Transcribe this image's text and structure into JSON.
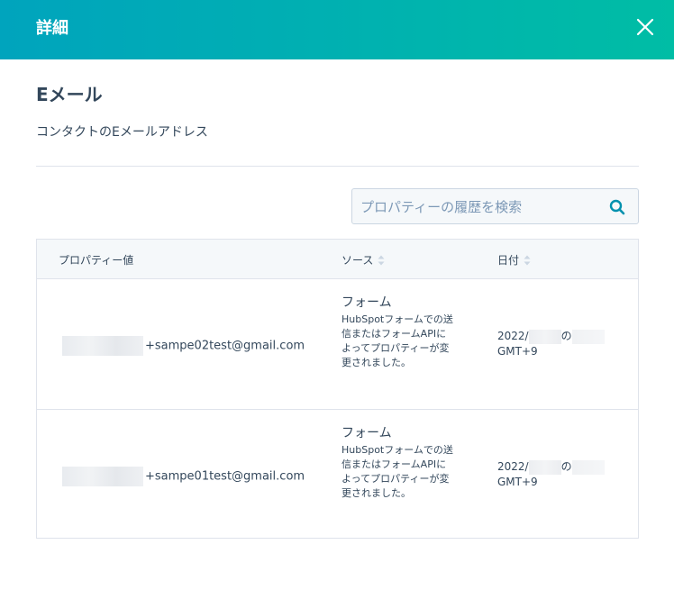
{
  "header": {
    "title": "詳細",
    "close_icon": "close-icon"
  },
  "property": {
    "title": "Eメール",
    "description": "コンタクトのEメールアドレス"
  },
  "search": {
    "placeholder": "プロパティーの履歴を検索",
    "value": "",
    "icon": "search-icon"
  },
  "table": {
    "columns": [
      "プロパティー値",
      "ソース",
      "日付"
    ],
    "rows": [
      {
        "value": "+sampe02test@gmail.com",
        "source_title": "フォーム",
        "source_desc": "HubSpotフォームでの送信またはフォームAPIによってプロパティーが変更されました。",
        "date_prefix": "2022/",
        "date_mid": "の",
        "date_tz": "GMT+9"
      },
      {
        "value": "+sampe01test@gmail.com",
        "source_title": "フォーム",
        "source_desc": "HubSpotフォームでの送信またはフォームAPIによってプロパティーが変更されました。",
        "date_prefix": "2022/",
        "date_mid": "の",
        "date_tz": "GMT+9"
      }
    ]
  },
  "colors": {
    "header_start": "#00a4bd",
    "header_end": "#00bda5",
    "text": "#33475b",
    "accent": "#0091ae"
  }
}
